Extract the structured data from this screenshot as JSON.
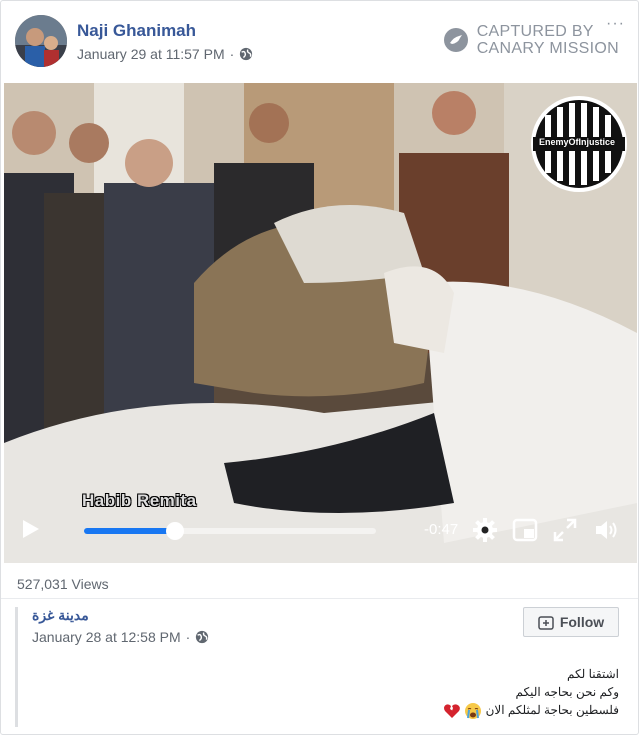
{
  "post": {
    "author": "Naji Ghanimah",
    "timestamp": "January 29 at 11:57 PM",
    "separator": "·",
    "privacy_icon": "globe-icon"
  },
  "watermark": {
    "line1": "CAPTURED BY",
    "line2": "CANARY MISSION",
    "more": "···"
  },
  "video": {
    "caption": "Habib Remita",
    "channel_logo_text": "EnemyOfInjustice",
    "time_remaining": "-0:47",
    "progress_fraction": 0.31,
    "controls": [
      "play-icon",
      "gear-icon",
      "pip-icon",
      "fullscreen-icon",
      "volume-icon"
    ]
  },
  "stats": {
    "views": "527,031 Views"
  },
  "shared_post": {
    "author": "مدينة غزة",
    "timestamp": "January 28 at 12:58 PM",
    "separator": "·",
    "follow_label": "Follow",
    "lines": [
      "اشتقنا لكم",
      "وكم نحن بحاجه اليكم",
      "فلسطين بحاجة لمثلكم الان"
    ],
    "emojis": [
      "crying-face",
      "broken-heart"
    ]
  },
  "colors": {
    "link": "#385898",
    "meta": "#606770",
    "progress": "#1877f2"
  }
}
